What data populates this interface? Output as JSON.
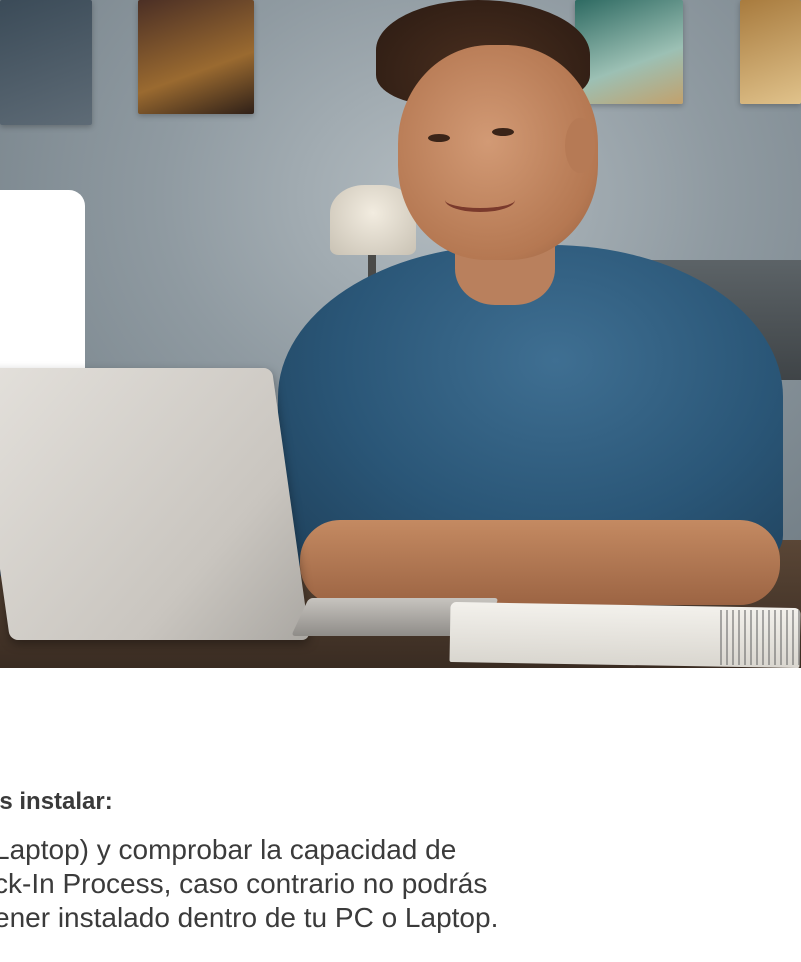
{
  "hero": {
    "image_alt": "Joven sonriente usando una laptop en su escritorio"
  },
  "content": {
    "heading": "es instalar:",
    "paragraph_lines": [
      "Laptop) y comprobar la capacidad de",
      "ck-In Process, caso contrario no podrás",
      "ener instalado dentro de tu PC o Laptop."
    ]
  },
  "colors": {
    "heading": "#3a3a3a",
    "body_text": "#3b3b3b",
    "background": "#ffffff"
  }
}
